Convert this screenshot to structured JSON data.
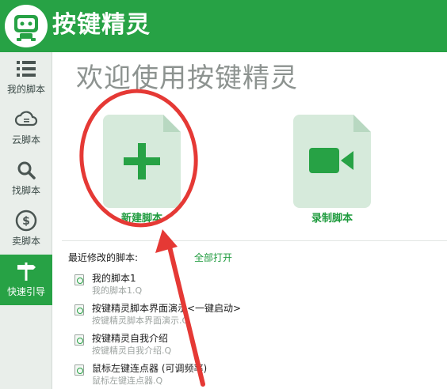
{
  "app": {
    "title": "按键精灵"
  },
  "sidebar": {
    "items": [
      {
        "label": "我的脚本",
        "icon": "list-icon",
        "active": false
      },
      {
        "label": "云脚本",
        "icon": "cloud-icon",
        "active": false
      },
      {
        "label": "找脚本",
        "icon": "search-icon",
        "active": false
      },
      {
        "label": "卖脚本",
        "icon": "dollar-icon",
        "active": false
      },
      {
        "label": "快速引导",
        "icon": "signpost-icon",
        "active": true
      }
    ]
  },
  "main": {
    "welcome": "欢迎使用按键精灵",
    "actions": [
      {
        "label": "新建脚本",
        "icon": "plus-icon"
      },
      {
        "label": "录制脚本",
        "icon": "video-camera-icon"
      }
    ],
    "recent": {
      "title": "最近修改的脚本:",
      "open_all": "全部打开",
      "items": [
        {
          "name": "我的脚本1",
          "file": "我的脚本1.Q"
        },
        {
          "name": "按键精灵脚本界面演示<一键启动>",
          "file": "按键精灵脚本界面演示.Q"
        },
        {
          "name": "按键精灵自我介绍",
          "file": "按键精灵自我介绍.Q"
        },
        {
          "name": "鼠标左键连点器 (可调频率)",
          "file": "鼠标左键连点器.Q"
        }
      ]
    }
  },
  "colors": {
    "brand": "#27a245",
    "card": "#d6eadb",
    "annotation": "#e53935"
  }
}
